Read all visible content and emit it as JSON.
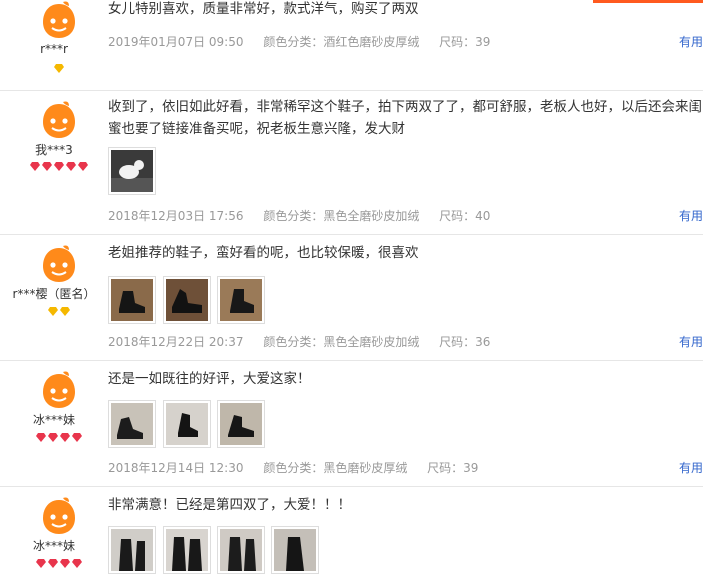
{
  "reviews": [
    {
      "username": "r***r",
      "text": "女儿特别喜欢，质量非常好，款式洋气，购买了两双",
      "date": "2019年01月07日 09:50",
      "sku": "颜色分类：酒红色磨砂皮厚绒",
      "size": "尺码：39",
      "helpful": "有用",
      "badge": "gold",
      "badge_count": 1
    },
    {
      "username": "我***3",
      "text": "收到了，依旧如此好看，非常稀罕这个鞋子，拍下两双了了，都可舒服，老板人也好，以后还会来闺蜜也要了链接准备买呢，祝老板生意兴隆，发大财",
      "date": "2018年12月03日 17:56",
      "sku": "颜色分类：黑色全磨砂皮加绒",
      "size": "尺码：40",
      "helpful": "有用",
      "badge": "red",
      "badge_count": 5
    },
    {
      "username": "r***樱（匿名）",
      "text": "老姐推荐的鞋子，蛮好看的呢，也比较保暖，很喜欢",
      "date": "2018年12月22日 20:37",
      "sku": "颜色分类：黑色全磨砂皮加绒",
      "size": "尺码：36",
      "helpful": "有用",
      "badge": "gold",
      "badge_count": 2
    },
    {
      "username": "冰***妹",
      "text": "还是一如既往的好评，大爱这家！",
      "date": "2018年12月14日 12:30",
      "sku": "颜色分类：黑色磨砂皮厚绒",
      "size": "尺码：39",
      "helpful": "有用",
      "badge": "red",
      "badge_count": 4
    },
    {
      "username": "冰***妹",
      "text": "非常满意！已经是第四双了，大爱！！！",
      "date": "",
      "sku": "",
      "size": "",
      "helpful": "",
      "badge": "red",
      "badge_count": 4
    }
  ],
  "colors": {
    "link": "#3366cc",
    "meta": "#999999",
    "accent": "#ff5a1f"
  }
}
